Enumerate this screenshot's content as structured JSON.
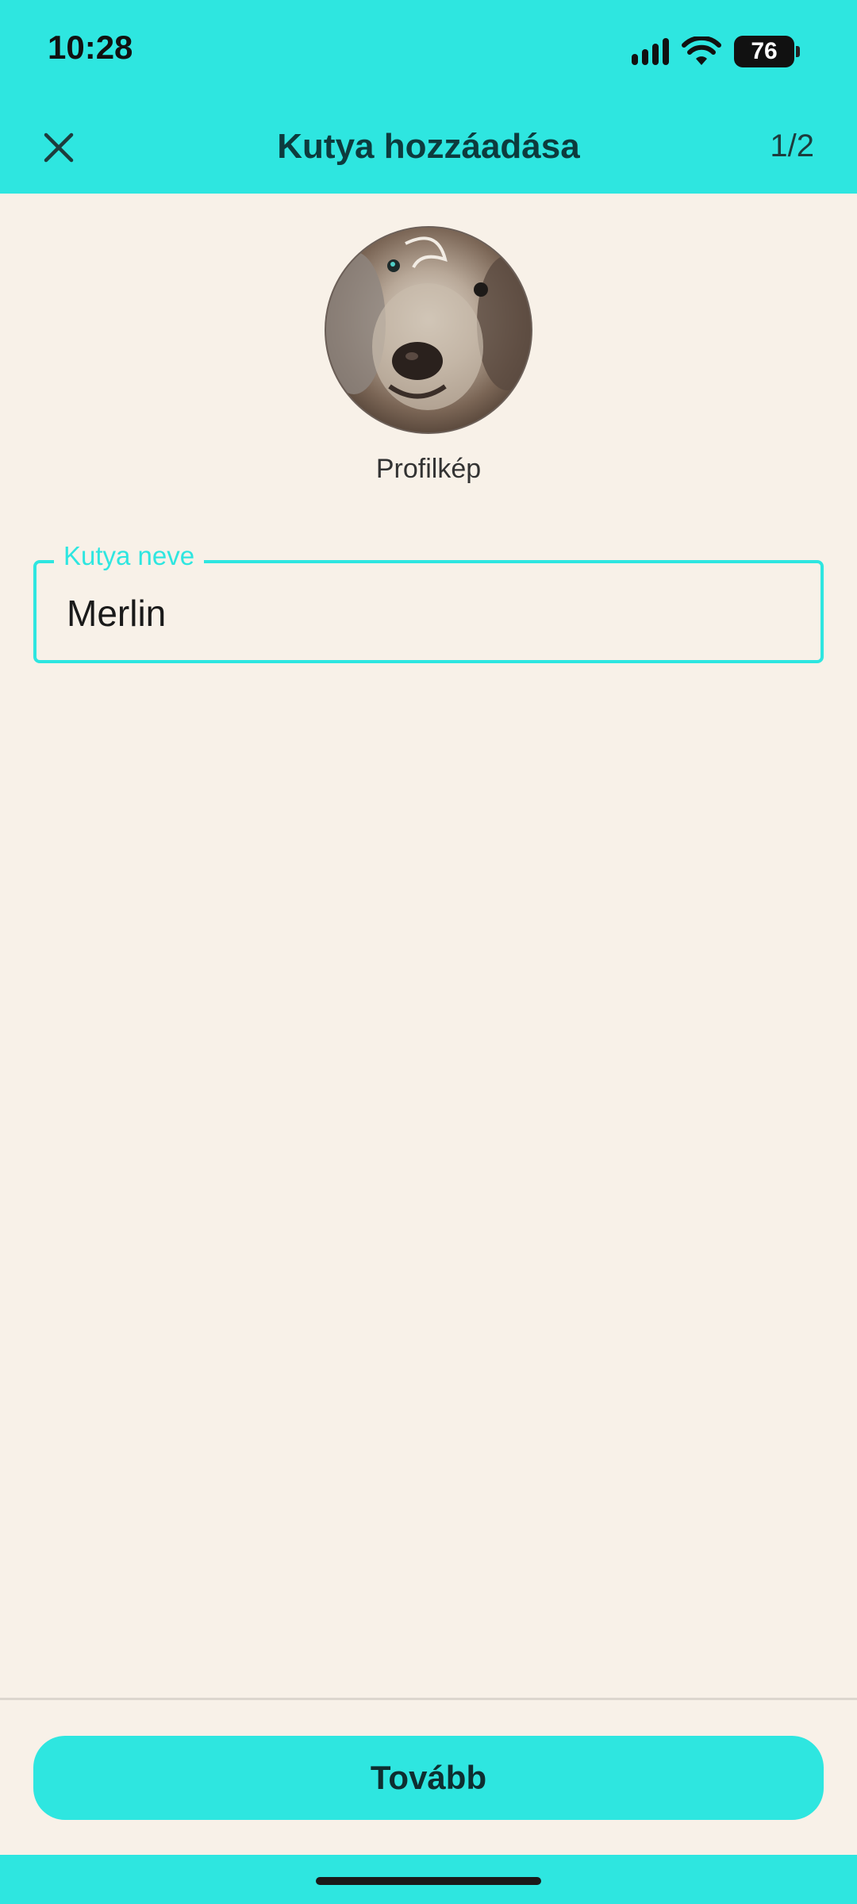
{
  "status_bar": {
    "time": "10:28",
    "battery": "76",
    "icons": [
      "signal-icon",
      "wifi-icon",
      "battery-icon"
    ]
  },
  "app_bar": {
    "title": "Kutya hozzáadása",
    "step": "1/2",
    "close_icon": "close-icon"
  },
  "profile": {
    "label": "Profilkép"
  },
  "form": {
    "name_label": "Kutya neve",
    "name_value": "Merlin"
  },
  "actions": {
    "next_label": "Tovább"
  },
  "colors": {
    "accent": "#2ee6e0",
    "background": "#f8f1e8",
    "title_text": "#0d3b3d"
  }
}
